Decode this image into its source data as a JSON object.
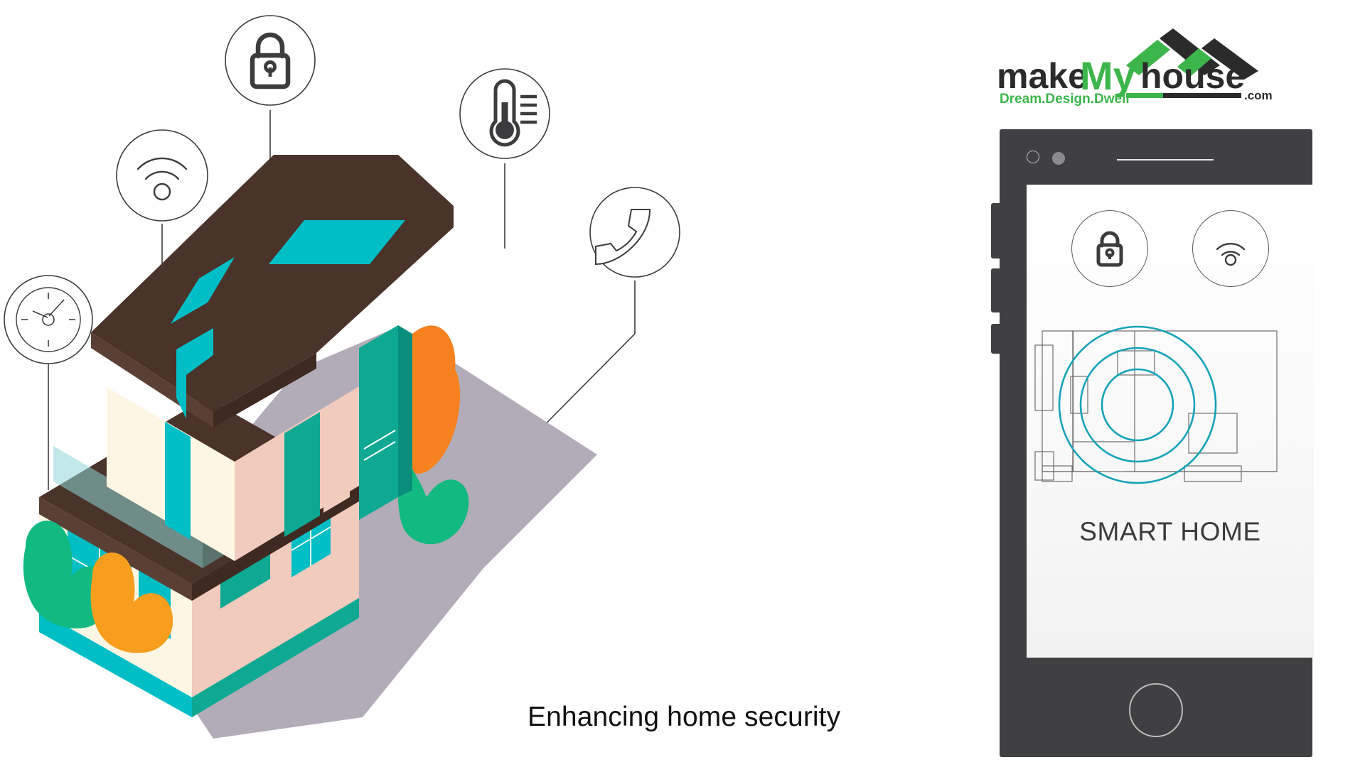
{
  "caption": {
    "text": "Enhancing home security"
  },
  "brand": {
    "name_part_1": "make",
    "name_part_2": "My",
    "name_part_3": "house",
    "tagline": "Dream.Design.Dwell",
    "domain_suffix": ".com",
    "color_dark": "#2B2B2B",
    "color_green": "#3CB54A"
  },
  "feature_icons": [
    {
      "name": "clock-icon",
      "label": "Clock / scheduling"
    },
    {
      "name": "wifi-icon",
      "label": "Wi-Fi connectivity"
    },
    {
      "name": "lock-icon",
      "label": "Smart lock"
    },
    {
      "name": "thermometer-icon",
      "label": "Temperature control"
    },
    {
      "name": "phone-icon",
      "label": "Phone / call"
    }
  ],
  "phone": {
    "screen_title": "SMART HOME",
    "app_icons": [
      {
        "name": "lock-icon",
        "label": "Lock"
      },
      {
        "name": "wifi-icon",
        "label": "Wi-Fi"
      }
    ],
    "hardware": {
      "camera": "front-camera",
      "sensor": "proximity-sensor",
      "speaker": "earpiece-speaker",
      "home_button": "home-button",
      "side_buttons": [
        "volume-button",
        "power-button",
        "extra-button"
      ]
    },
    "frame_color": "#403F41",
    "screen_bg": "#F6F6F6"
  },
  "floorplan": {
    "circle_color": "#16A2B8",
    "wall_color": "#6E6E70",
    "circle_count": 3,
    "room_count": 8
  },
  "illustration": {
    "title": "isometric-smart-house",
    "colors": {
      "roof_dark": "#4A3329",
      "roof_shade": "#5A4034",
      "teal": "#00BEC6",
      "teal_deep": "#0EA893",
      "cream": "#FDF6E3",
      "blush": "#F1CBBD",
      "orange": "#F5821F",
      "orange_light": "#F79E1F",
      "green": "#12B981",
      "green_dark": "#0FA070",
      "shadow": "#B2ACB8",
      "glass": "#8FD5D8"
    }
  }
}
